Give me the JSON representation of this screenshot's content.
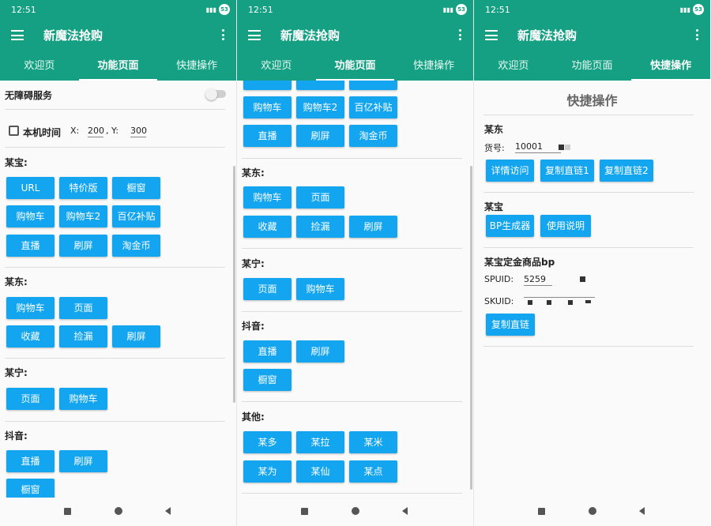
{
  "status_time": "12:51",
  "battery": "53",
  "app_title": "新魔法抢购",
  "tabs": [
    "欢迎页",
    "功能页面",
    "快捷操作"
  ],
  "panel1": {
    "accessibility_label": "无障碍服务",
    "localtime_label": "本机时间",
    "x_label": "X:",
    "x_value": "200",
    "y_label": ", Y:",
    "y_value": "300",
    "mt_label": "某宝:",
    "mt_buttons": [
      "URL",
      "特价版",
      "橱窗",
      "购物车",
      "购物车2",
      "百亿补贴",
      "直播",
      "刷屏",
      "淘金币"
    ],
    "md_label": "某东:",
    "md_buttons": [
      "购物车",
      "页面",
      "收藏",
      "捡漏",
      "刷屏"
    ],
    "mn_label": "某宁:",
    "mn_buttons": [
      "页面",
      "购物车"
    ],
    "dy_label": "抖音:",
    "dy_buttons": [
      "直播",
      "刷屏",
      "橱窗"
    ]
  },
  "panel2": {
    "mt_buttons": [
      "购物车",
      "购物车2",
      "百亿补贴",
      "直播",
      "刷屏",
      "淘金币"
    ],
    "md_label": "某东:",
    "md_buttons": [
      "购物车",
      "页面",
      "收藏",
      "捡漏",
      "刷屏"
    ],
    "mn_label": "某宁:",
    "mn_buttons": [
      "页面",
      "购物车"
    ],
    "dy_label": "抖音:",
    "dy_buttons": [
      "直播",
      "刷屏",
      "橱窗"
    ],
    "other_label": "其他:",
    "other_buttons": [
      "某多",
      "某拉",
      "某米",
      "某为",
      "某仙",
      "某点"
    ]
  },
  "panel3": {
    "heading": "快捷操作",
    "jd_label": "某东",
    "sku_label": "货号:",
    "sku_value": "10001",
    "jd_buttons": [
      "详情访问",
      "复制直链1",
      "复制直链2"
    ],
    "tb_label": "某宝",
    "tb_buttons": [
      "BP生成器",
      "使用说明"
    ],
    "deposit_label": "某宝定金商品bp",
    "spuid_label": "SPUID:",
    "spuid_value": "5259",
    "skuid_label": "SKUID:",
    "copy_button": "复制直链"
  }
}
